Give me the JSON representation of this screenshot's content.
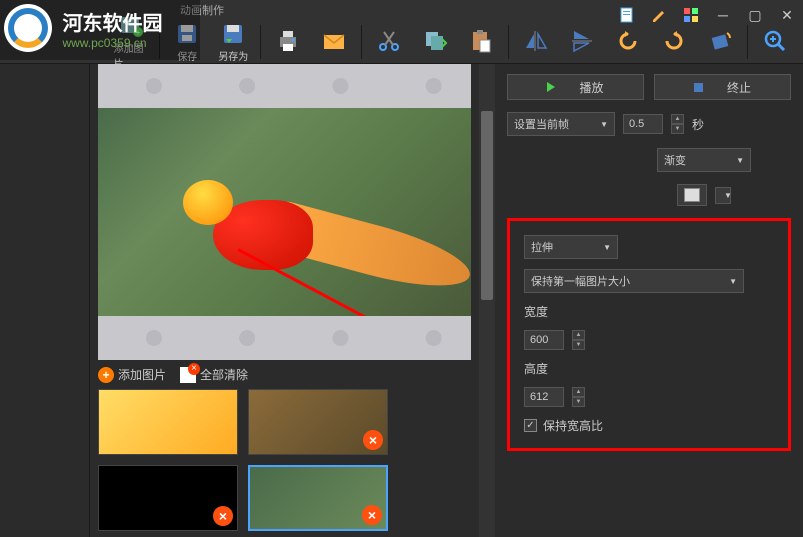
{
  "logo": {
    "cn": "河东软件园",
    "url": "www.pc0359.cn"
  },
  "title": "动画制作",
  "toolbar": {
    "add_image": "添加图片",
    "save": "保存",
    "save_as": "另存为"
  },
  "playback": {
    "play": "播放",
    "stop": "终止"
  },
  "frame": {
    "set_current": "设置当前帧",
    "duration_value": "0.5",
    "duration_unit": "秒",
    "transition": "渐变"
  },
  "size_panel": {
    "mode": "拉伸",
    "keep_size": "保持第一幅图片大小",
    "width_label": "宽度",
    "width_value": "600",
    "height_label": "高度",
    "height_value": "612",
    "aspect_label": "保持宽高比",
    "aspect_checked": true
  },
  "thumbs": {
    "add": "添加图片",
    "clear": "全部清除"
  }
}
